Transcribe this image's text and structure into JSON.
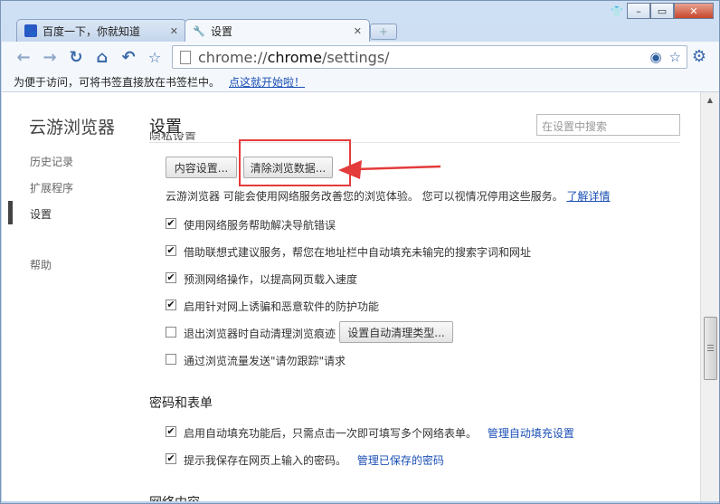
{
  "tabs": [
    {
      "label": "百度一下，你就知道",
      "icon": "paw-icon"
    },
    {
      "label": "设置",
      "icon": "wrench-icon"
    }
  ],
  "address": {
    "scheme": "chrome://",
    "host": "chrome",
    "path": "/settings/"
  },
  "bookmark_bar": {
    "text": "为便于访问，可将书签直接放在书签栏中。",
    "link": "点这就开始啦！"
  },
  "sidebar": {
    "brand": "云游浏览器",
    "items": [
      "历史记录",
      "扩展程序",
      "设置",
      "帮助"
    ]
  },
  "main": {
    "title": "设置",
    "search_placeholder": "在设置中搜索",
    "cut_section": "隐私设置",
    "content_settings_button": "内容设置...",
    "clear_data_button": "清除浏览数据...",
    "privacy_desc": "云游浏览器 可能会使用网络服务改善您的浏览体验。 您可以视情况停用这些服务。",
    "learn_more": "了解详情",
    "options": [
      {
        "label": "使用网络服务帮助解决导航错误",
        "checked": true
      },
      {
        "label": "借助联想式建议服务，帮您在地址栏中自动填充未输完的搜索字词和网址",
        "checked": true
      },
      {
        "label": "预测网络操作，以提高网页载入速度",
        "checked": true
      },
      {
        "label": "启用针对网上诱骗和恶意软件的防护功能",
        "checked": true
      },
      {
        "label": "退出浏览器时自动清理浏览痕迹",
        "checked": false
      },
      {
        "label": "通过浏览流量发送\"请勿跟踪\"请求",
        "checked": false
      }
    ],
    "auto_clean_button": "设置自动清理类型...",
    "passwords_title": "密码和表单",
    "autofill_text": "启用自动填充功能后，只需点击一次即可填写多个网络表单。",
    "autofill_link": "管理自动填充设置",
    "save_pw_text": "提示我保存在网页上输入的密码。",
    "save_pw_link": "管理已保存的密码",
    "next_section": "网络内容"
  },
  "colors": {
    "highlight": "#e43b3b",
    "link": "#1a4fb5",
    "toolbar_icon": "#3c6aa8"
  }
}
